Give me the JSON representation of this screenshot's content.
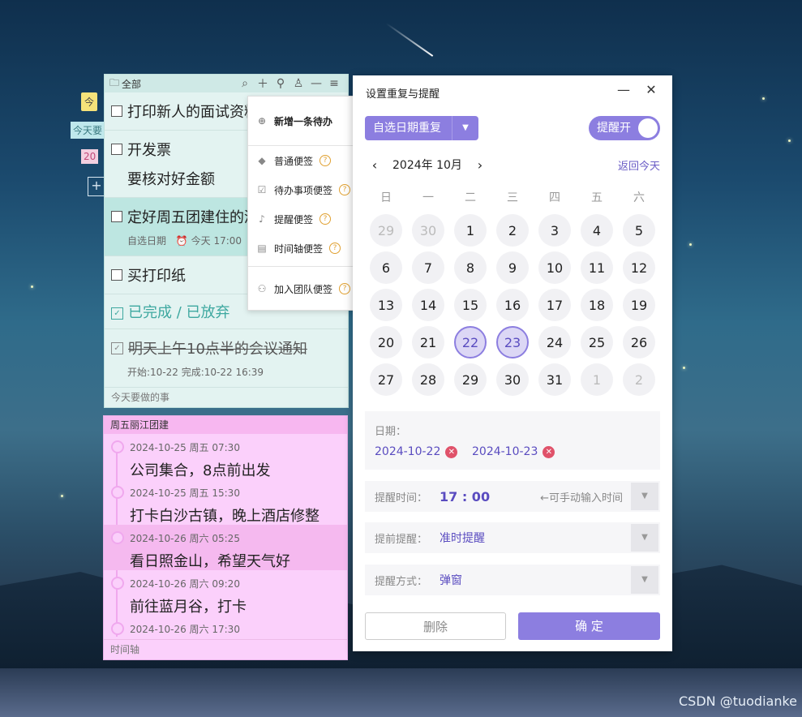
{
  "side_tags": {
    "t1": "今",
    "t2": "今天要",
    "t3": "20",
    "t4": "+"
  },
  "todo": {
    "folder": "全部",
    "items": [
      {
        "text": "打印新人的面试资料"
      },
      {
        "text": "开发票",
        "text2": "要核对好金额"
      },
      {
        "text": "定好周五团建住的酒店",
        "date_tag": "自选日期",
        "time": "今天 17:00"
      },
      {
        "text": "买打印纸"
      }
    ],
    "done_header": "已完成 / 已放弃",
    "done_item": {
      "text": "明天上午10点半的会议通知",
      "meta": "开始:10-22 完成:10-22 16:39"
    },
    "footer": "今天要做的事"
  },
  "menu": {
    "new_todo": "新增一条待办",
    "items": [
      "普通便签",
      "待办事项便签",
      "提醒便签",
      "时间轴便签"
    ],
    "team": "加入团队便签",
    "help": "?"
  },
  "timeline": {
    "title": "周五丽江团建",
    "items": [
      {
        "date": "2024-10-25 周五 07:30",
        "text": "公司集合，8点前出发"
      },
      {
        "date": "2024-10-25 周五 15:30",
        "text": "打卡白沙古镇，晚上酒店修整"
      },
      {
        "date": "2024-10-26 周六 05:25",
        "text": "看日照金山，希望天气好"
      },
      {
        "date": "2024-10-26 周六 09:20",
        "text": "前往蓝月谷，打卡"
      },
      {
        "date": "2024-10-26 周六 17:30",
        "text": ""
      }
    ],
    "footer": "时间轴"
  },
  "dialog": {
    "title": "设置重复与提醒",
    "repeat_label": "自选日期重复",
    "toggle_label": "提醒开",
    "month": "2024年 10月",
    "back_today": "返回今天",
    "weekdays": [
      "日",
      "一",
      "二",
      "三",
      "四",
      "五",
      "六"
    ],
    "days": [
      "29",
      "30",
      "1",
      "2",
      "3",
      "4",
      "5",
      "6",
      "7",
      "8",
      "9",
      "10",
      "11",
      "12",
      "13",
      "14",
      "15",
      "16",
      "17",
      "18",
      "19",
      "20",
      "21",
      "22",
      "23",
      "24",
      "25",
      "26",
      "27",
      "28",
      "29",
      "30",
      "31",
      "1",
      "2"
    ],
    "other_month_idx": [
      0,
      1,
      33,
      34
    ],
    "selected_idx": [
      23,
      24
    ],
    "dates_label": "日期：",
    "dates": [
      "2024-10-22",
      "2024-10-23"
    ],
    "remind_time_label": "提醒时间：",
    "remind_time": "17 : 00",
    "remind_time_hint": "←可手动输入时间",
    "advance_label": "提前提醒：",
    "advance_value": "准时提醒",
    "method_label": "提醒方式：",
    "method_value": "弹窗",
    "delete": "删除",
    "ok": "确 定"
  },
  "watermark": "CSDN @tuodianke"
}
